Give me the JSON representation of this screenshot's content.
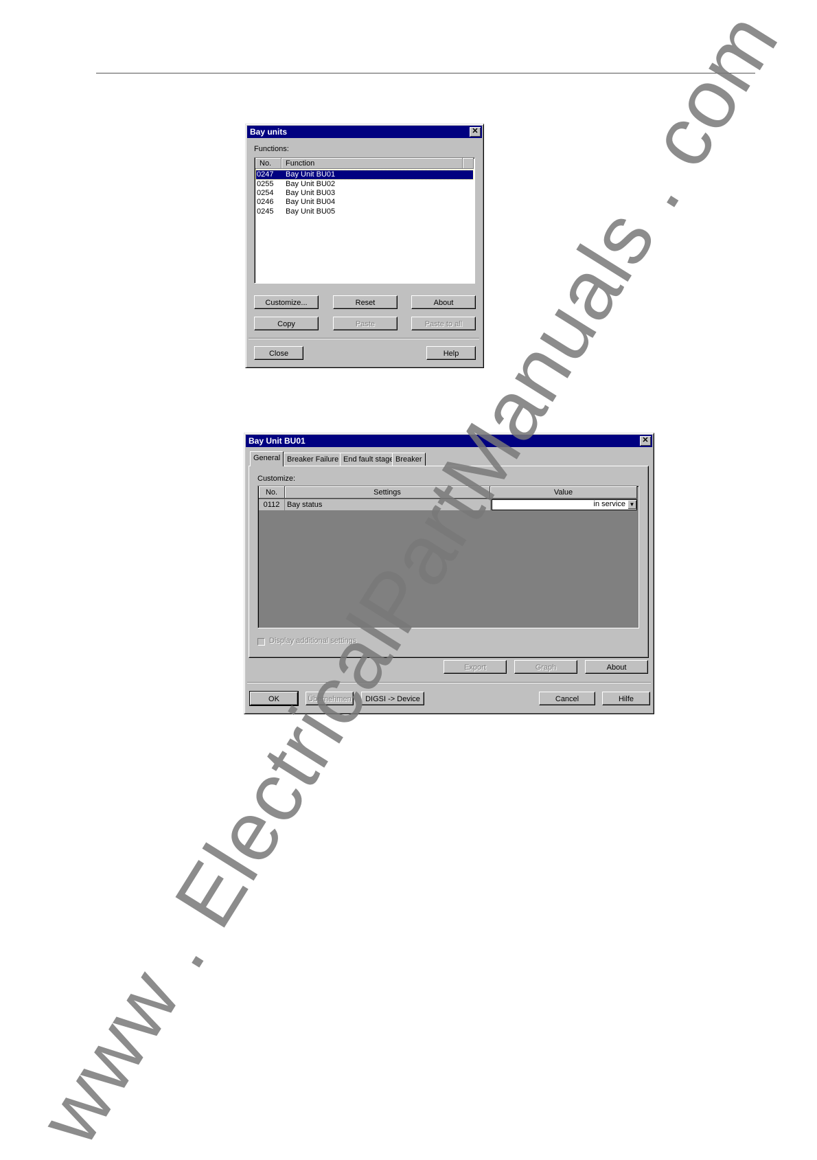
{
  "dialog1": {
    "title": "Bay units",
    "functions_label": "Functions:",
    "columns": [
      "No.",
      "Function"
    ],
    "rows": [
      {
        "no": "0247",
        "function": "Bay Unit BU01",
        "selected": true
      },
      {
        "no": "0255",
        "function": "Bay Unit BU02"
      },
      {
        "no": "0254",
        "function": "Bay Unit BU03"
      },
      {
        "no": "0246",
        "function": "Bay Unit BU04"
      },
      {
        "no": "0245",
        "function": "Bay Unit BU05"
      }
    ],
    "buttons": {
      "customize": "Customize...",
      "reset": "Reset",
      "about": "About",
      "copy": "Copy",
      "paste": "Paste",
      "paste_to_all": "Paste to all",
      "close": "Close",
      "help": "Help"
    }
  },
  "dialog2": {
    "title": "Bay Unit BU01",
    "tabs": [
      "General",
      "Breaker Failure",
      "End fault stage",
      "Breaker"
    ],
    "customize_label": "Customize:",
    "columns": [
      "No.",
      "Settings",
      "Value"
    ],
    "rows": [
      {
        "no": "0112",
        "setting": "Bay status",
        "value": "in service"
      }
    ],
    "checkbox_label": "Display additional settings",
    "buttons": {
      "export": "Export",
      "graph": "Graph",
      "about": "About",
      "ok": "OK",
      "uebernehmen": "Übernehmen",
      "digsi_device": "DIGSI -> Device",
      "cancel": "Cancel",
      "hilfe": "Hilfe"
    }
  },
  "watermark": "www . ElectricalPartManuals . com"
}
